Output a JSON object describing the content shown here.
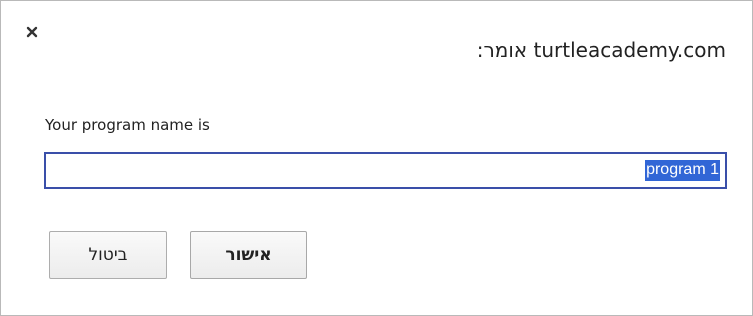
{
  "dialog": {
    "title": "turtleacademy.com אומר:",
    "prompt": "Your program name is",
    "input_value": "program 1",
    "cancel_label": "ביטול",
    "ok_label": "אישור",
    "close_icon": "close-icon"
  }
}
